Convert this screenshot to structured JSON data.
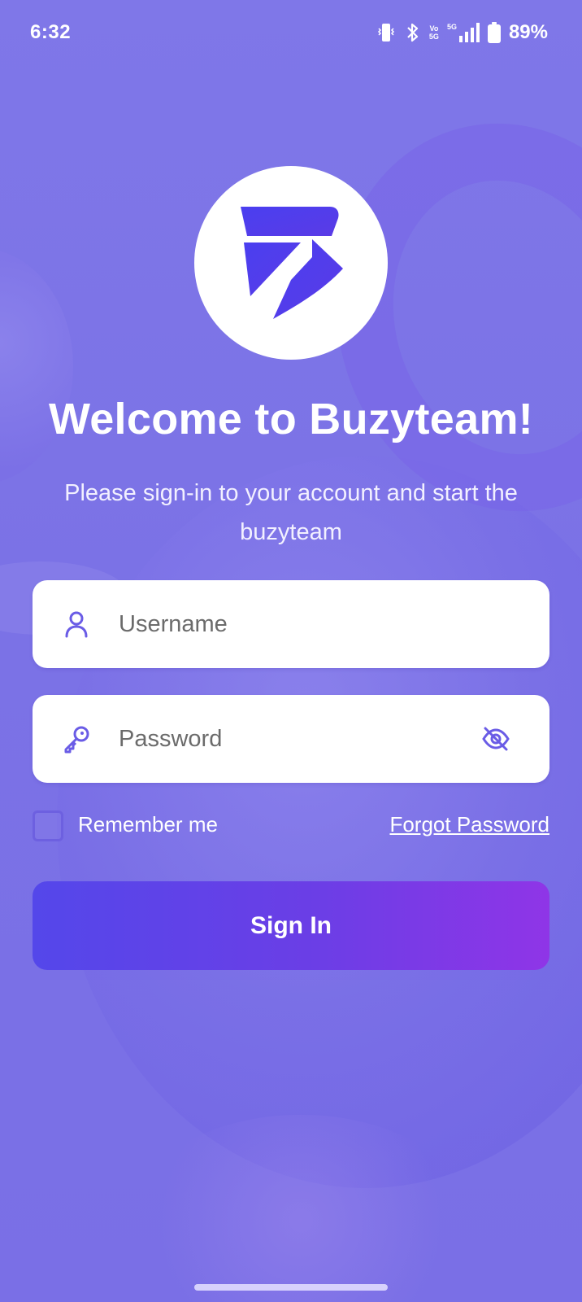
{
  "status_bar": {
    "time": "6:32",
    "battery_percent": "89%",
    "network_label_top": "Vo",
    "network_label_bottom": "5G",
    "signal_label": "5G",
    "icons": [
      "vibrate-icon",
      "bluetooth-icon",
      "volte-icon",
      "signal-icon",
      "battery-icon"
    ]
  },
  "logo": {
    "icon": "buzyteam-logo-icon",
    "color": "#4f3dea"
  },
  "welcome": {
    "title": "Welcome to Buzyteam!",
    "subtitle": "Please sign-in to your account and start the buzyteam"
  },
  "form": {
    "username": {
      "placeholder": "Username",
      "value": "",
      "icon": "user-icon"
    },
    "password": {
      "placeholder": "Password",
      "value": "",
      "icon": "key-icon",
      "toggle_icon": "eye-off-icon"
    },
    "remember_me": {
      "label": "Remember me",
      "checked": false
    },
    "forgot_password_label": "Forgot Password",
    "submit_label": "Sign In"
  },
  "colors": {
    "background": "#7b72e6",
    "accent": "#6a5ce6",
    "button_gradient_start": "#5447ea",
    "button_gradient_end": "#8f35e7",
    "text_light": "#ffffff"
  }
}
